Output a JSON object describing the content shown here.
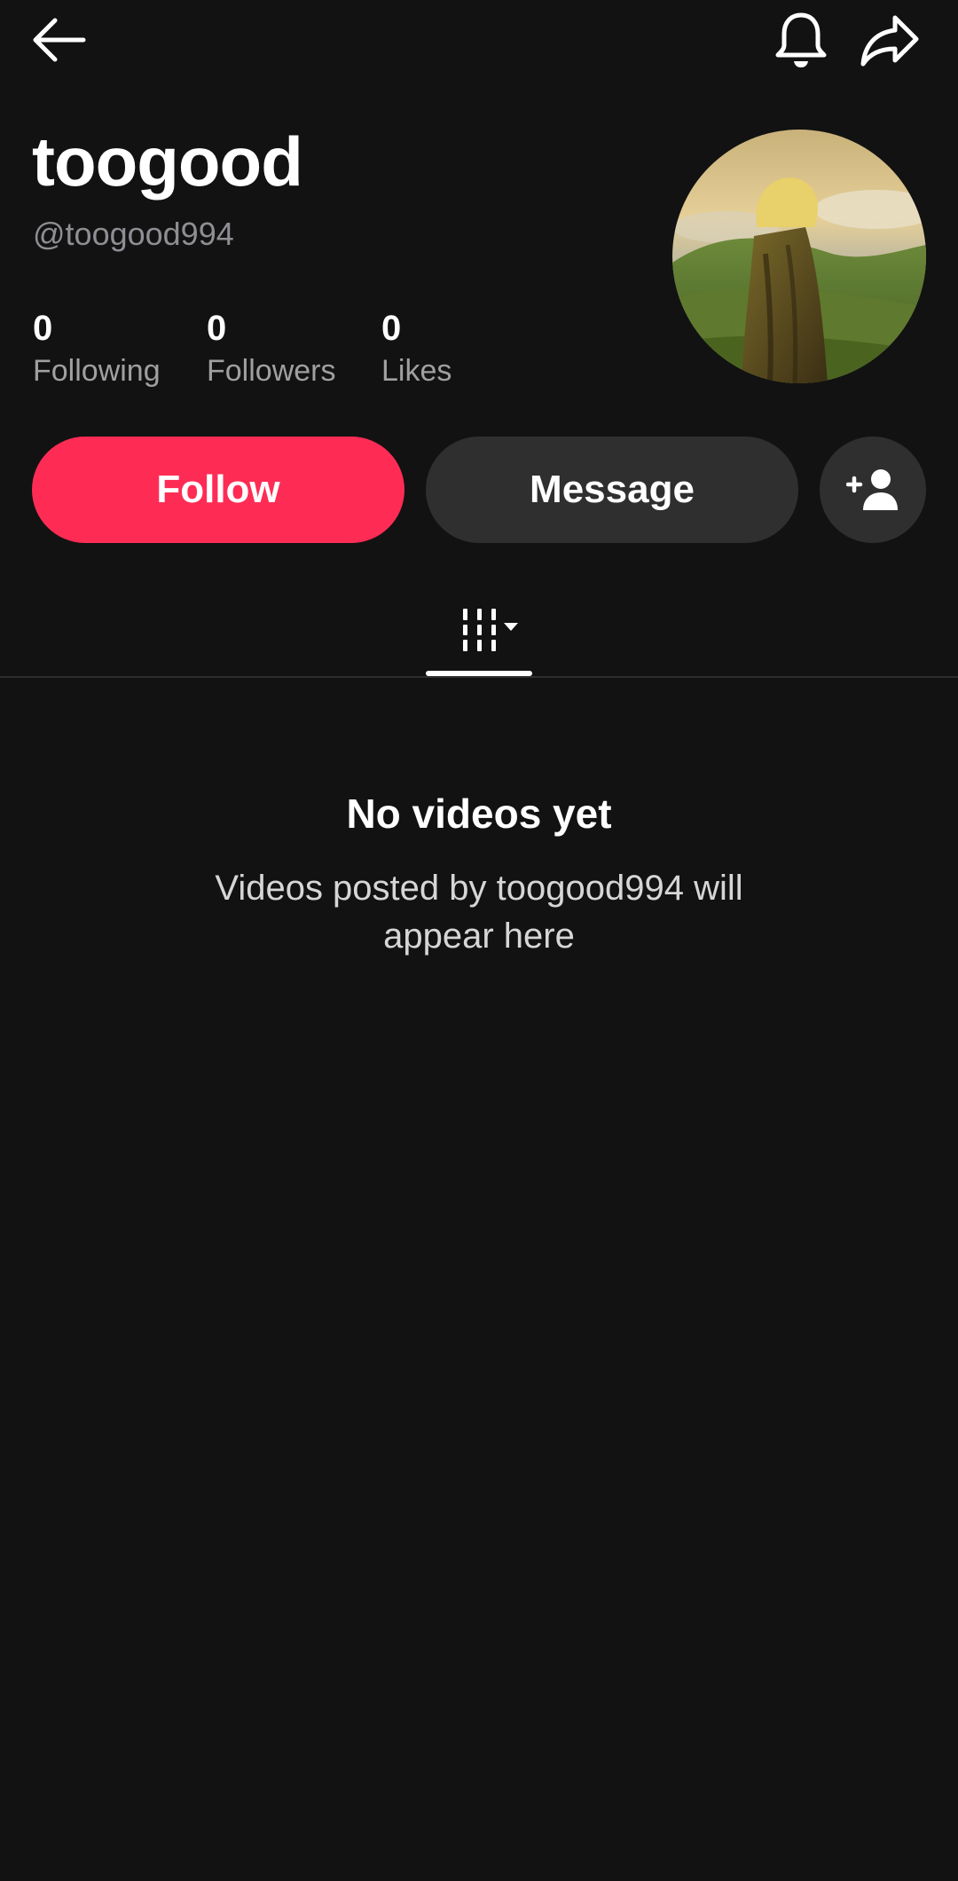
{
  "profile": {
    "display_name": "toogood",
    "handle": "@toogood994",
    "avatar_alt": "profile-avatar"
  },
  "stats": {
    "following_count": "0",
    "following_label": "Following",
    "followers_count": "0",
    "followers_label": "Followers",
    "likes_count": "0",
    "likes_label": "Likes"
  },
  "actions": {
    "follow_label": "Follow",
    "message_label": "Message"
  },
  "empty_state": {
    "title": "No videos yet",
    "description": "Videos posted by toogood994 will appear here"
  },
  "colors": {
    "background": "#121212",
    "follow": "#fe2c55",
    "secondary_button": "#2f2f2f"
  },
  "icons": {
    "back": "arrow-left-icon",
    "notifications": "bell-icon",
    "share": "share-arrow-icon",
    "add_friend": "person-add-icon",
    "videos_tab": "grid-dropdown-icon"
  }
}
